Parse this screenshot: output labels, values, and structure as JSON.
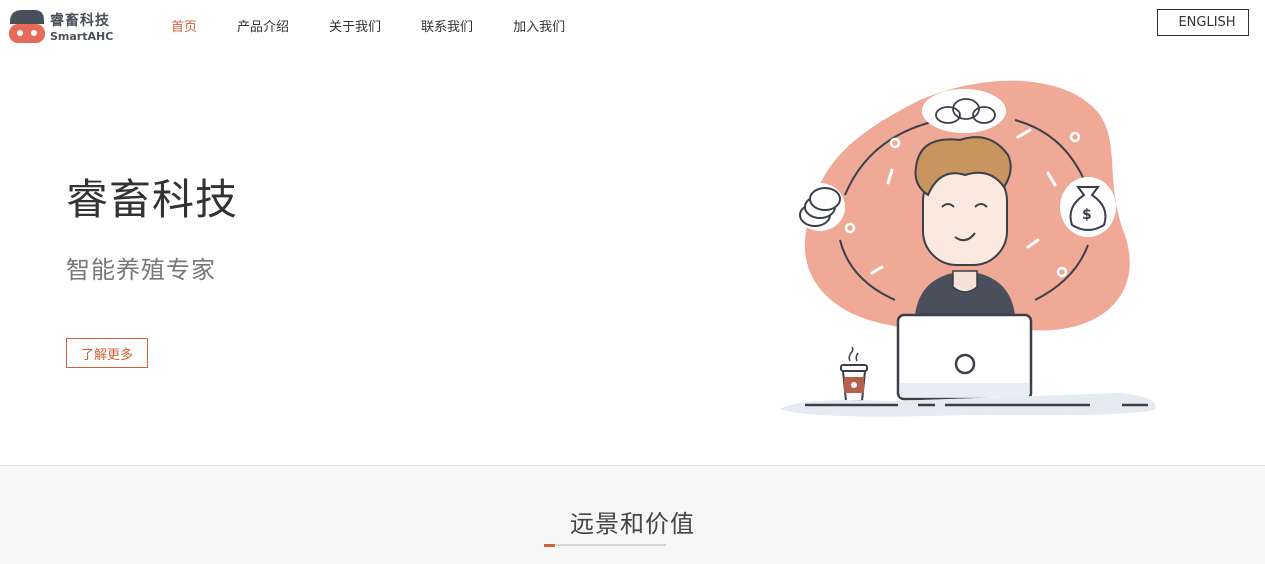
{
  "logo": {
    "name_cn": "睿畜科技",
    "name_en": "SmartAHC"
  },
  "nav": {
    "items": [
      {
        "label": "首页",
        "active": true
      },
      {
        "label": "产品介绍",
        "active": false
      },
      {
        "label": "关于我们",
        "active": false
      },
      {
        "label": "联系我们",
        "active": false
      },
      {
        "label": "加入我们",
        "active": false
      }
    ],
    "language_button": "ENGLISH"
  },
  "hero": {
    "title": "睿畜科技",
    "subtitle": "智能养殖专家",
    "cta_label": "了解更多"
  },
  "section": {
    "title": "远景和价值"
  },
  "colors": {
    "accent": "#d2603b",
    "illustration_blob": "#f0a996",
    "logo_dark": "#4a4f5c",
    "logo_red": "#e86a5b"
  },
  "icons": [
    "pig-logo-icon",
    "pigs-thought-icon",
    "money-bag-icon",
    "coins-icon",
    "coffee-cup-icon",
    "laptop-icon"
  ]
}
